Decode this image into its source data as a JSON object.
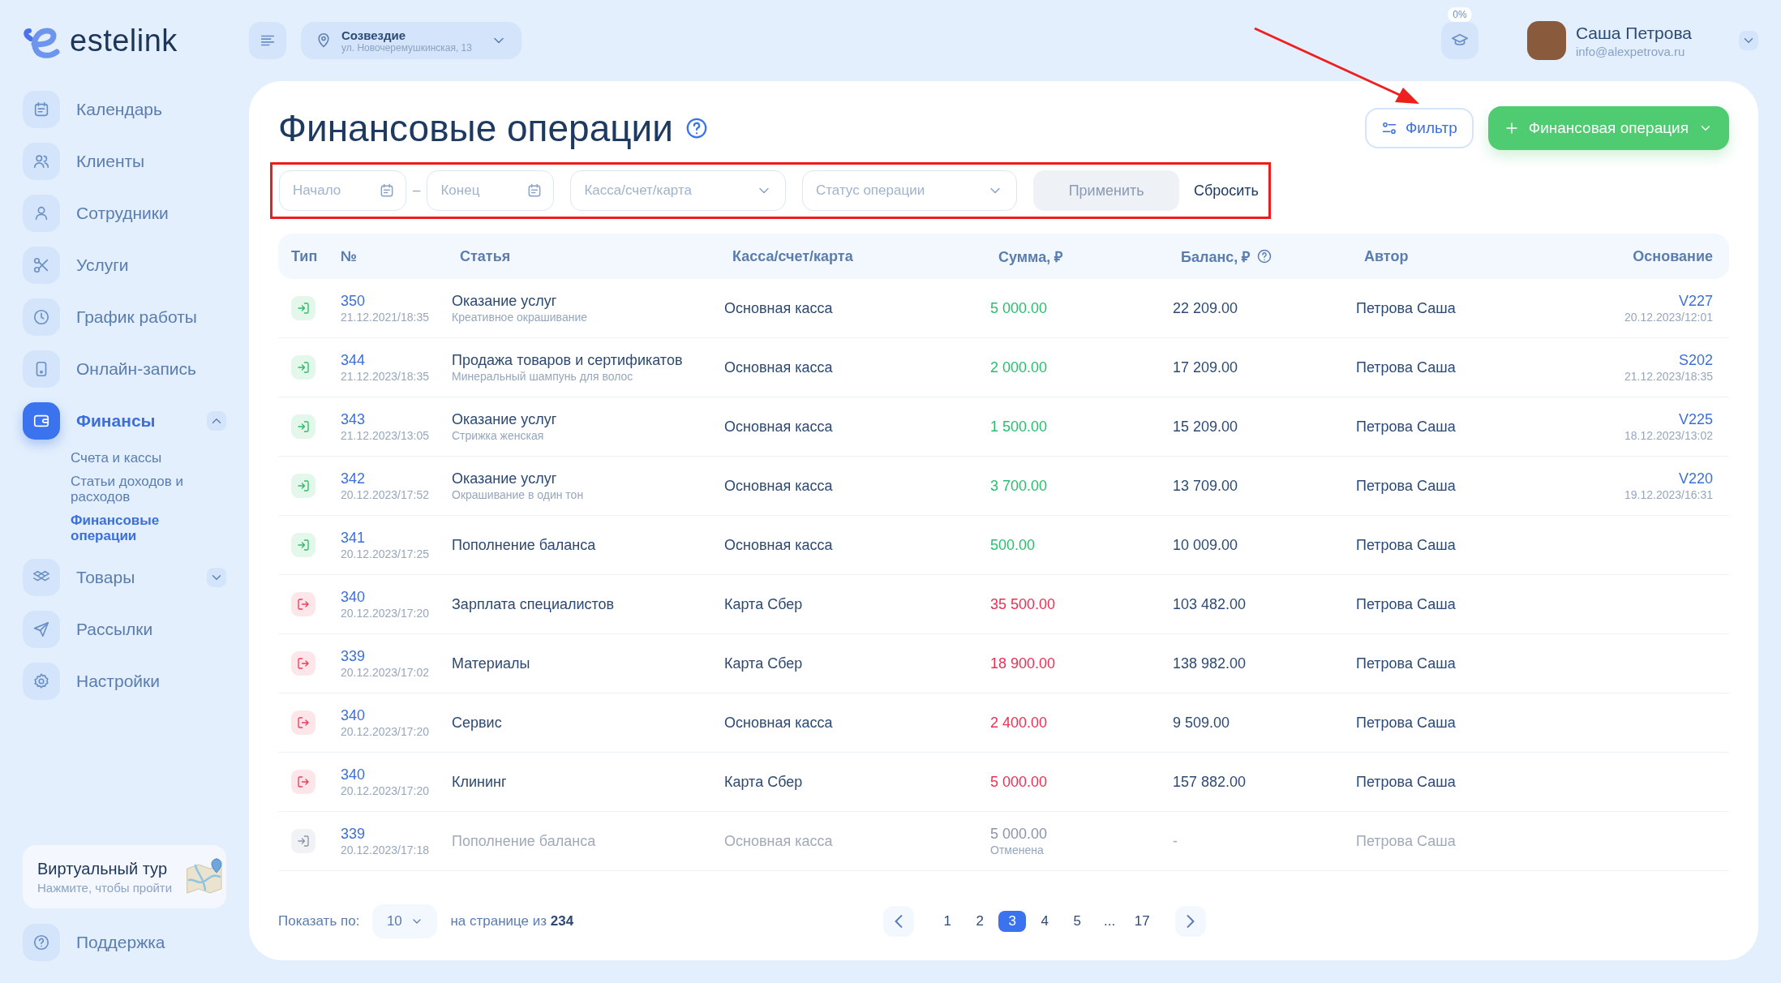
{
  "logo": {
    "text": "estelink"
  },
  "topbar": {
    "location": {
      "name": "Созвездие",
      "address": "ул. Новочеремушкинская, 13"
    },
    "progress_badge": "0%",
    "user": {
      "name": "Саша Петрова",
      "email": "info@alexpetrova.ru"
    }
  },
  "sidebar": {
    "items": [
      {
        "label": "Календарь",
        "selected": false
      },
      {
        "label": "Клиенты",
        "selected": false
      },
      {
        "label": "Сотрудники",
        "selected": false
      },
      {
        "label": "Услуги",
        "selected": false
      },
      {
        "label": "График работы",
        "selected": false
      },
      {
        "label": "Онлайн-запись",
        "selected": false
      },
      {
        "label": "Финансы",
        "selected": true,
        "expanded": true,
        "children": [
          {
            "label": "Счета и кассы",
            "selected": false
          },
          {
            "label": "Статьи доходов и расходов",
            "selected": false
          },
          {
            "label": "Финансовые операции",
            "selected": true
          }
        ]
      },
      {
        "label": "Товары",
        "selected": false,
        "expanded": false
      },
      {
        "label": "Рассылки",
        "selected": false
      },
      {
        "label": "Настройки",
        "selected": false
      }
    ],
    "tour_card": {
      "title": "Виртуальный тур",
      "subtitle": "Нажмите, чтобы пройти"
    },
    "support": {
      "label": "Поддержка"
    }
  },
  "page": {
    "title": "Финансовые операции",
    "filter_button": "Фильтр",
    "add_button": "Финансовая операция"
  },
  "filters": {
    "start": {
      "placeholder": "Начало"
    },
    "separator": "–",
    "end": {
      "placeholder": "Конец"
    },
    "account": {
      "placeholder": "Касса/счет/карта"
    },
    "status": {
      "placeholder": "Статус операции"
    },
    "apply": {
      "label": "Применить",
      "disabled": true
    },
    "reset": "Сбросить"
  },
  "table": {
    "columns": [
      {
        "label": "Тип",
        "info": false
      },
      {
        "label": "№",
        "info": false
      },
      {
        "label": "Статья",
        "info": false
      },
      {
        "label": "Касса/счет/карта",
        "info": false
      },
      {
        "label": "Сумма, ₽",
        "info": false
      },
      {
        "label": "Баланс, ₽",
        "info": true
      },
      {
        "label": "Автор",
        "info": false
      },
      {
        "label": "Основание",
        "info": false
      }
    ],
    "rows": [
      {
        "kind": "income",
        "cancelled": false,
        "number": "350",
        "datetime": "21.12.2021/18:35",
        "article": "Оказание услуг",
        "article_note": "Креативное окрашивание",
        "account": "Основная касса",
        "amount": "5 000.00",
        "balance": "22 209.00",
        "author": "Петрова Саша",
        "basis": "V227",
        "basis_date": "20.12.2023/12:01"
      },
      {
        "kind": "income",
        "cancelled": false,
        "number": "344",
        "datetime": "21.12.2023/18:35",
        "article": "Продажа товаров и сертификатов",
        "article_note": "Минеральный шампунь для волос",
        "account": "Основная касса",
        "amount": "2 000.00",
        "balance": "17 209.00",
        "author": "Петрова Саша",
        "basis": "S202",
        "basis_date": "21.12.2023/18:35"
      },
      {
        "kind": "income",
        "cancelled": false,
        "number": "343",
        "datetime": "21.12.2023/13:05",
        "article": "Оказание услуг",
        "article_note": "Стрижка женская",
        "account": "Основная касса",
        "amount": "1 500.00",
        "balance": "15 209.00",
        "author": "Петрова Саша",
        "basis": "V225",
        "basis_date": "18.12.2023/13:02"
      },
      {
        "kind": "income",
        "cancelled": false,
        "number": "342",
        "datetime": "20.12.2023/17:52",
        "article": "Оказание услуг",
        "article_note": "Окрашивание в один тон",
        "account": "Основная касса",
        "amount": "3 700.00",
        "balance": "13 709.00",
        "author": "Петрова Саша",
        "basis": "V220",
        "basis_date": "19.12.2023/16:31"
      },
      {
        "kind": "income",
        "cancelled": false,
        "number": "341",
        "datetime": "20.12.2023/17:25",
        "article": "Пополнение баланса",
        "account": "Основная касса",
        "amount": "500.00",
        "balance": "10 009.00",
        "author": "Петрова Саша"
      },
      {
        "kind": "expense",
        "cancelled": false,
        "number": "340",
        "datetime": "20.12.2023/17:20",
        "article": "Зарплата специалистов",
        "account": "Карта Сбер",
        "amount": "35 500.00",
        "balance": "103 482.00",
        "author": "Петрова Саша"
      },
      {
        "kind": "expense",
        "cancelled": false,
        "number": "339",
        "datetime": "20.12.2023/17:02",
        "article": "Материалы",
        "account": "Карта Сбер",
        "amount": "18 900.00",
        "balance": "138 982.00",
        "author": "Петрова Саша"
      },
      {
        "kind": "expense",
        "cancelled": false,
        "number": "340",
        "datetime": "20.12.2023/17:20",
        "article": "Сервис",
        "account": "Основная касса",
        "amount": "2 400.00",
        "balance": "9 509.00",
        "author": "Петрова Саша"
      },
      {
        "kind": "expense",
        "cancelled": false,
        "number": "340",
        "datetime": "20.12.2023/17:20",
        "article": "Клининг",
        "account": "Карта Сбер",
        "amount": "5 000.00",
        "balance": "157 882.00",
        "author": "Петрова Саша"
      },
      {
        "kind": "income",
        "cancelled": true,
        "number": "339",
        "datetime": "20.12.2023/17:18",
        "article": "Пополнение баланса",
        "account": "Основная касса",
        "amount": "5 000.00",
        "status_note": "Отменена",
        "balance": "-",
        "author": "Петрова Саша"
      }
    ]
  },
  "pagination": {
    "show_label": "Показать по:",
    "page_size": "10",
    "range_text": "на странице из **234**",
    "pages": [
      {
        "label": "1",
        "selected": false
      },
      {
        "label": "2",
        "selected": false
      },
      {
        "label": "3",
        "selected": true
      },
      {
        "label": "4",
        "selected": false
      },
      {
        "label": "5",
        "selected": false
      },
      {
        "label": "...",
        "selected": false
      },
      {
        "label": "17",
        "selected": false
      }
    ]
  }
}
